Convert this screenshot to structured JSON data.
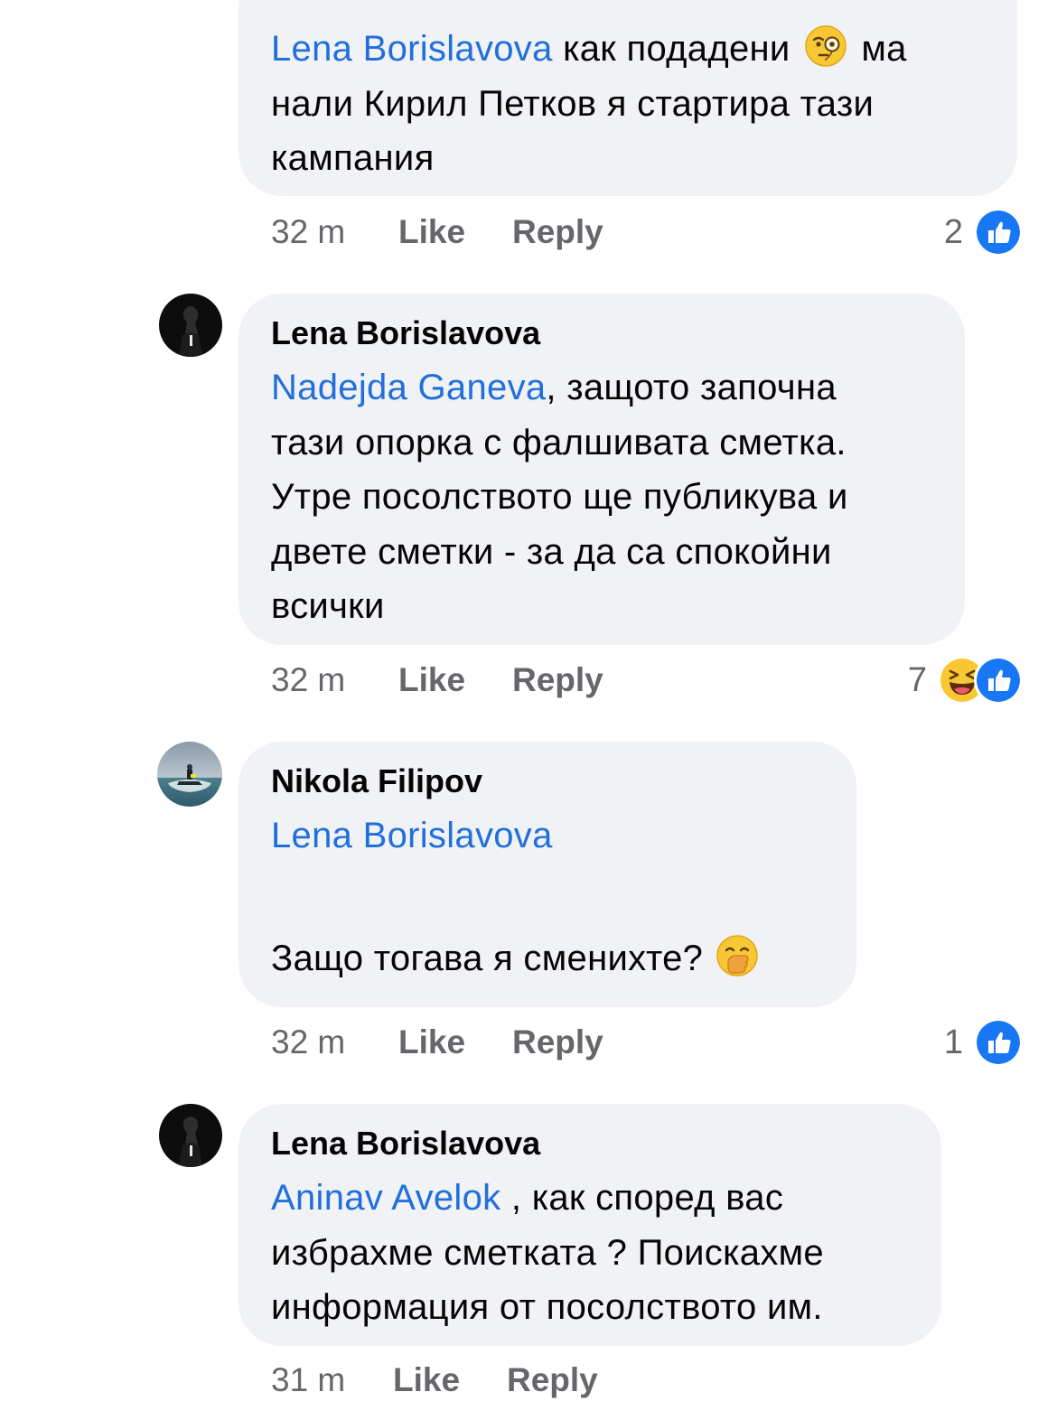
{
  "comments": [
    {
      "author": "",
      "mention": "Lena Borislavova",
      "text_line1": " как подадени ",
      "text_after_emoji": " ма",
      "text_rest": "нали Кирил Петков я стартира тази\nкампания",
      "emoji_icon": "face-with-monocle-icon",
      "time": "32 m",
      "like": "Like",
      "reply": "Reply",
      "reaction_count": "2",
      "reactions": [
        "like-reaction-icon"
      ]
    },
    {
      "author": "Lena Borislavova",
      "mention": "Nadejda Ganeva",
      "text": ", защото започна\nтази опорка с фалшивата сметка.\nУтре посолството ще публикува и\nдвете сметки - за да са спокойни\nвсички",
      "time": "32 m",
      "like": "Like",
      "reply": "Reply",
      "reaction_count": "7",
      "reactions": [
        "haha-reaction-icon",
        "like-reaction-icon"
      ]
    },
    {
      "author": "Nikola Filipov",
      "mention": "Lena Borislavova",
      "text": "Защо тогава я сменихте?",
      "emoji_icon": "face-with-hand-over-mouth-icon",
      "time": "32 m",
      "like": "Like",
      "reply": "Reply",
      "reaction_count": "1",
      "reactions": [
        "like-reaction-icon"
      ]
    },
    {
      "author": "Lena Borislavova",
      "mention": "Aninav Avelok",
      "text": " , как според вас\nизбрахме сметката ? Поискахме\nинформация от посолството им.",
      "time": "31 m",
      "like": "Like",
      "reply": "Reply"
    }
  ],
  "colors": {
    "mention": "#216fdb",
    "bubble": "#f0f2f5",
    "meta": "#65676b",
    "like_blue": "#1877f2"
  }
}
